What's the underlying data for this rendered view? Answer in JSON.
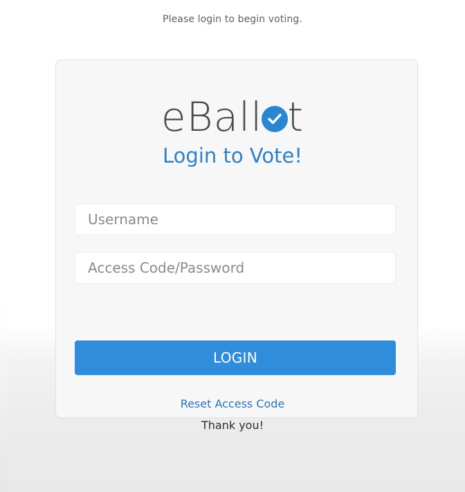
{
  "intro_text": "Please login to begin voting.",
  "logo": {
    "text_before": "eBall",
    "text_after": "t",
    "icon": "checkmark-circle-icon",
    "accent_color": "#2a86d1"
  },
  "subtitle": "Login to Vote!",
  "form": {
    "username_placeholder": "Username",
    "username_value": "",
    "password_placeholder": "Access Code/Password",
    "password_value": ""
  },
  "login_button_label": "LOGIN",
  "reset_link_label": "Reset Access Code",
  "footer_text": "Thank you!",
  "colors": {
    "button": "#2f8ddc",
    "link": "#2a73b8",
    "subtitle": "#2f80c6"
  }
}
